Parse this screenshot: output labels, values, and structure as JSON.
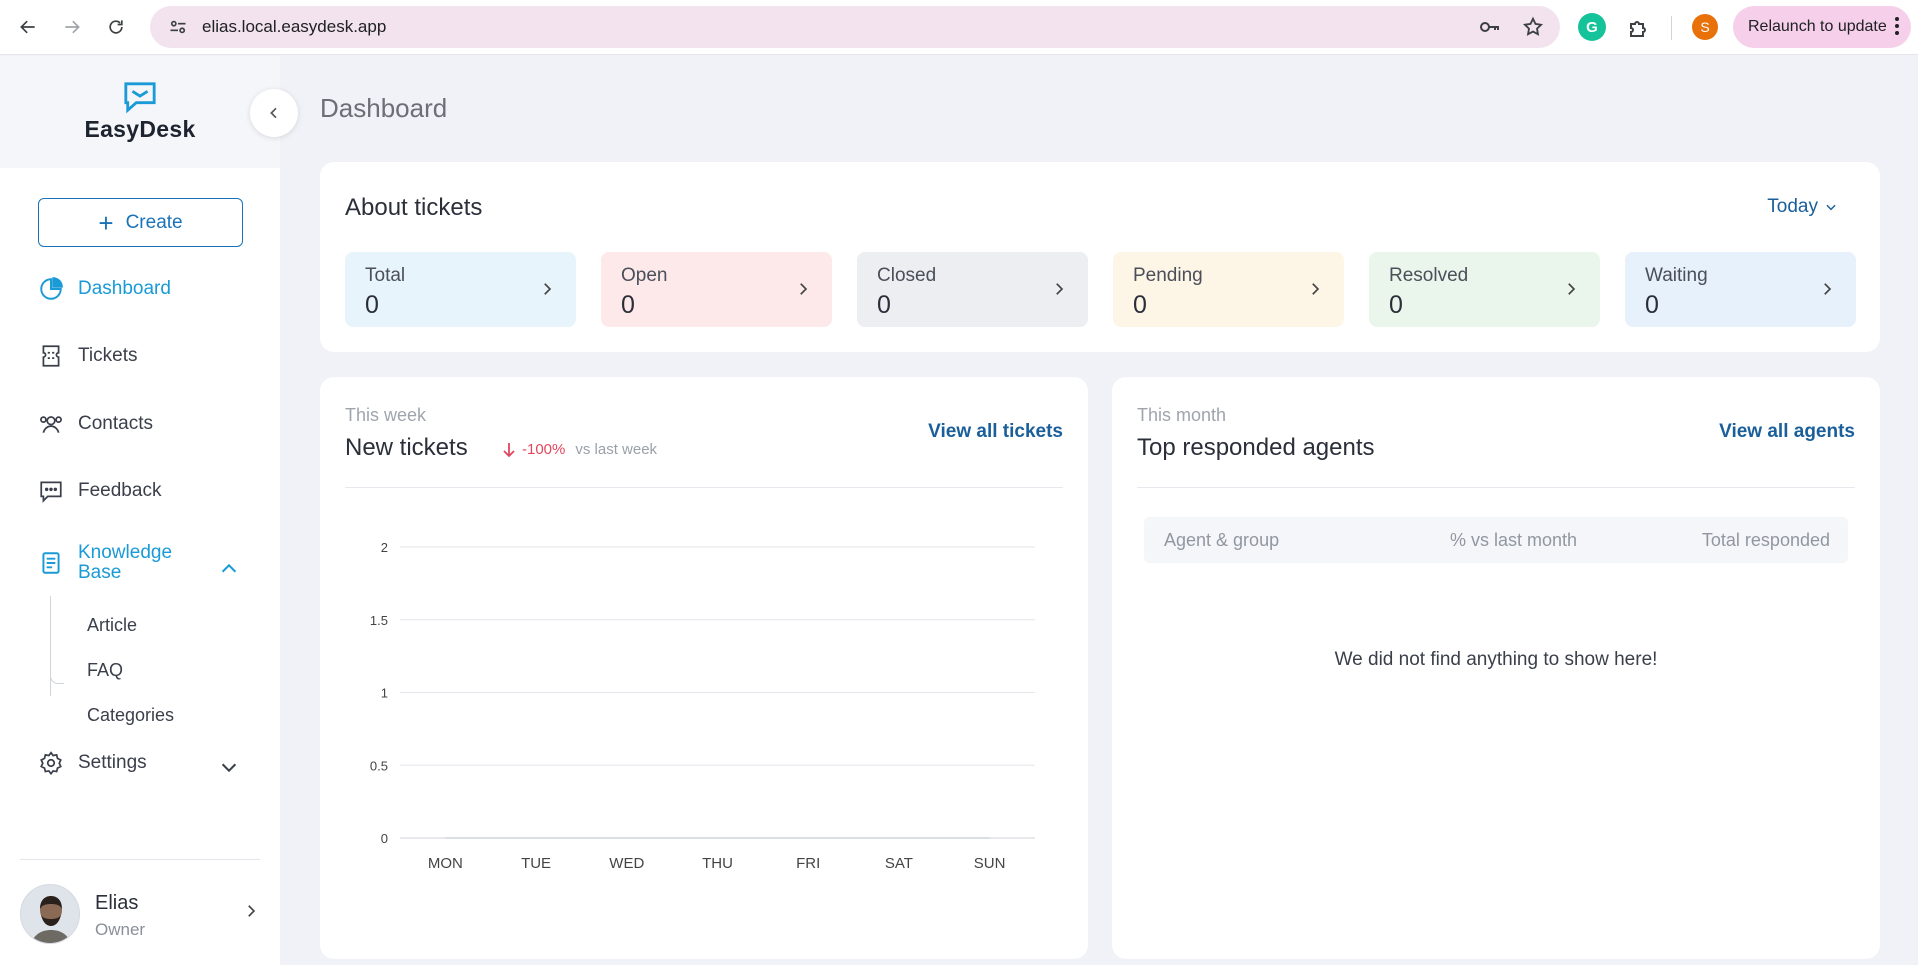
{
  "browser": {
    "url": "elias.local.easydesk.app",
    "profile_initial": "S",
    "relaunch_label": "Relaunch to update"
  },
  "sidebar": {
    "brand": "EasyDesk",
    "create_label": "Create",
    "nav": {
      "dashboard": "Dashboard",
      "tickets": "Tickets",
      "contacts": "Contacts",
      "feedback": "Feedback",
      "knowledge_base": "Knowledge Base",
      "settings": "Settings"
    },
    "kb_sub": [
      "Article",
      "FAQ",
      "Categories"
    ],
    "user": {
      "name": "Elias",
      "role": "Owner"
    }
  },
  "page": {
    "title": "Dashboard"
  },
  "about": {
    "title": "About tickets",
    "period": "Today",
    "stats": [
      {
        "label": "Total",
        "value": "0",
        "color": "#e8f4fb"
      },
      {
        "label": "Open",
        "value": "0",
        "color": "#fde8ea"
      },
      {
        "label": "Closed",
        "value": "0",
        "color": "#eceef1"
      },
      {
        "label": "Pending",
        "value": "0",
        "color": "#fdf5e6"
      },
      {
        "label": "Resolved",
        "value": "0",
        "color": "#eaf6ec"
      },
      {
        "label": "Waiting",
        "value": "0",
        "color": "#e6f1fb"
      }
    ]
  },
  "new_tickets": {
    "kicker": "This week",
    "title": "New tickets",
    "trend_pct": "-100%",
    "trend_vs": "vs last week",
    "link": "View all tickets"
  },
  "agents": {
    "kicker": "This month",
    "title": "Top responded agents",
    "link": "View all agents",
    "columns": [
      "Agent & group",
      "% vs last month",
      "Total responded"
    ],
    "empty": "We did not find anything to show here!"
  },
  "chart_data": {
    "type": "line",
    "categories": [
      "MON",
      "TUE",
      "WED",
      "THU",
      "FRI",
      "SAT",
      "SUN"
    ],
    "series": [
      {
        "values": [
          0,
          0,
          0,
          0,
          0,
          0,
          0
        ]
      }
    ],
    "yticks": [
      "0",
      "0.5",
      "1",
      "1.5",
      "2"
    ],
    "ylim": [
      0,
      2
    ],
    "grid": true
  },
  "colors": {
    "accent": "#1a9ad6",
    "link": "#1a5f9a",
    "negative": "#e2475e"
  }
}
